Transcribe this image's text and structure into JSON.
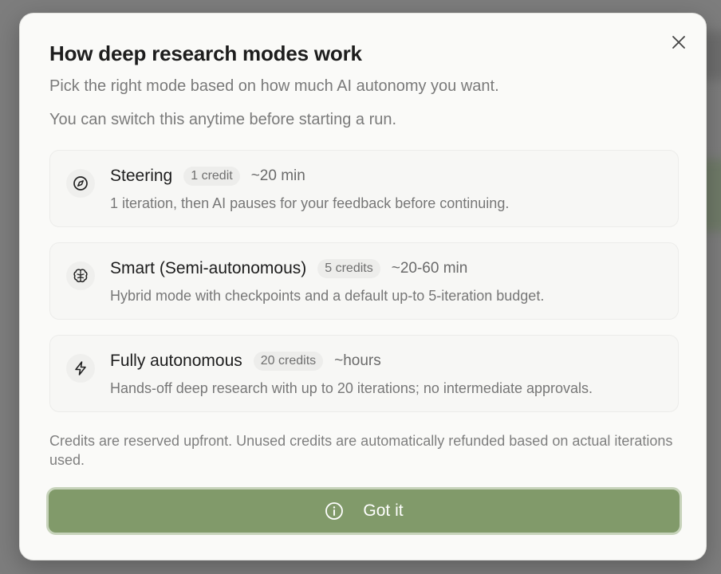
{
  "modal": {
    "title": "How deep research modes work",
    "subtitle_1": "Pick the right mode based on how much AI autonomy you want.",
    "subtitle_2": "You can switch this anytime before starting a run.",
    "close_icon": "close-icon",
    "modes": [
      {
        "name": "Steering",
        "credits": "1 credit",
        "duration": "~20 min",
        "description": "1 iteration, then AI pauses for your feedback before continuing.",
        "icon": "compass-icon"
      },
      {
        "name": "Smart (Semi-autonomous)",
        "credits": "5 credits",
        "duration": "~20-60 min",
        "description": "Hybrid mode with checkpoints and a default up-to 5-iteration budget.",
        "icon": "brain-icon"
      },
      {
        "name": "Fully autonomous",
        "credits": "20 credits",
        "duration": "~hours",
        "description": "Hands-off deep research with up to 20 iterations; no intermediate approvals.",
        "icon": "lightning-icon"
      }
    ],
    "footnote": "Credits are reserved upfront. Unused credits are automatically refunded based on actual iterations used.",
    "confirm_label": "Got it",
    "confirm_icon": "info-icon"
  },
  "colors": {
    "accent": "#819a6a",
    "accent_border": "#c7d3bb",
    "backdrop": "#7d7d7d",
    "surface": "#fafaf8"
  }
}
